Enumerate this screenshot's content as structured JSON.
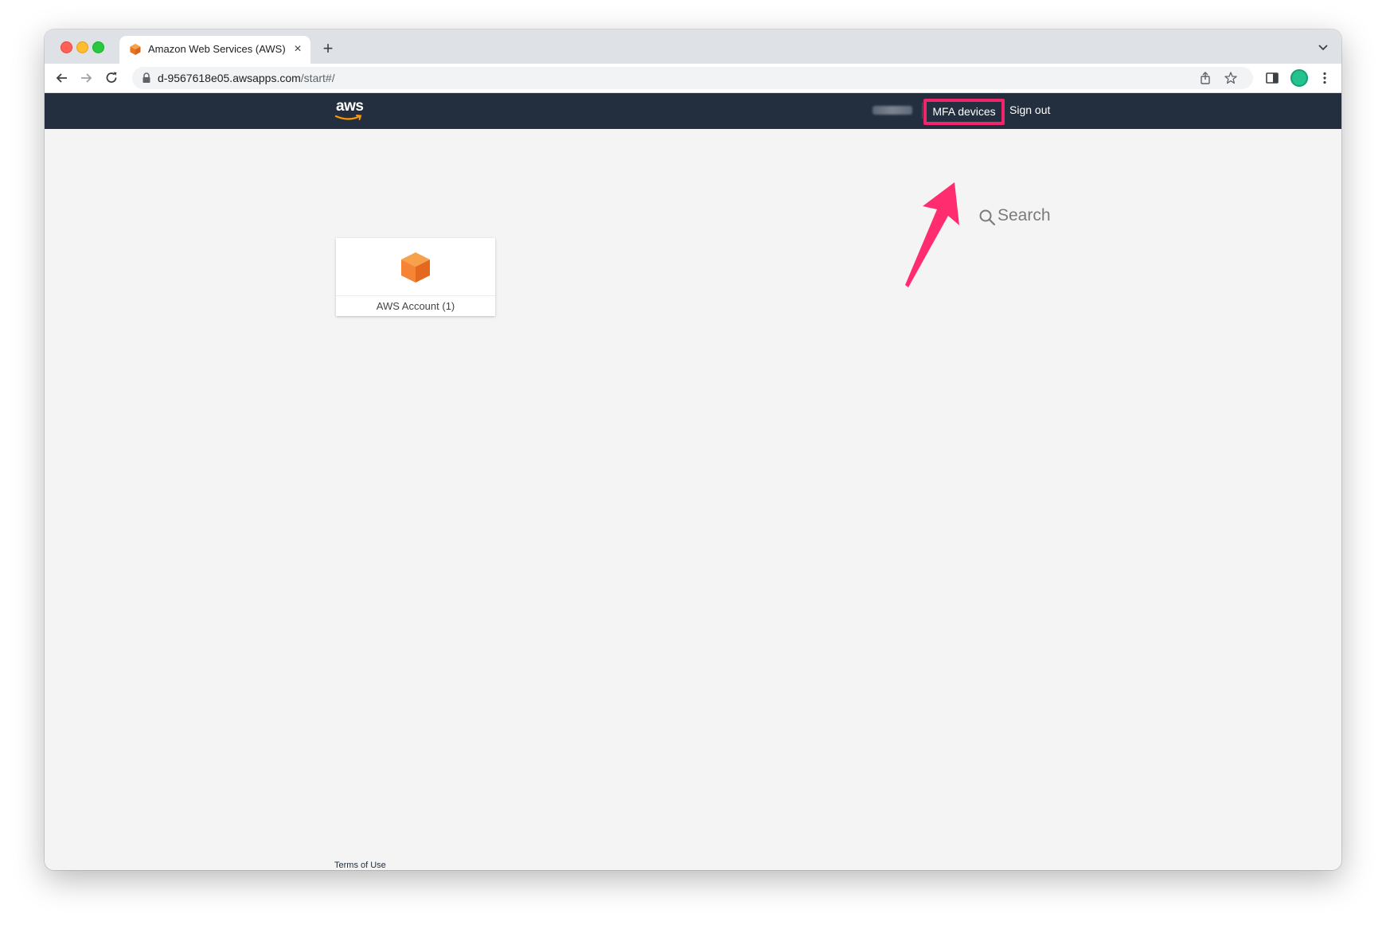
{
  "browser": {
    "tab_title": "Amazon Web Services (AWS)",
    "close_glyph": "×",
    "new_tab_glyph": "+",
    "url_host": "d-9567618e05.awsapps.com",
    "url_path": "/start#/"
  },
  "header": {
    "logo_text": "aws",
    "mfa_label": "MFA devices",
    "signout_label": "Sign out"
  },
  "search": {
    "label": "Search"
  },
  "apps": [
    {
      "label": "AWS Account (1)",
      "icon": "aws-account-cube-icon"
    }
  ],
  "footer": {
    "terms_label": "Terms of Use"
  },
  "colors": {
    "header_bg": "#232f3e",
    "highlight": "#f0266d",
    "cube_orange": "#f58534",
    "page_bg": "#f4f4f4"
  }
}
